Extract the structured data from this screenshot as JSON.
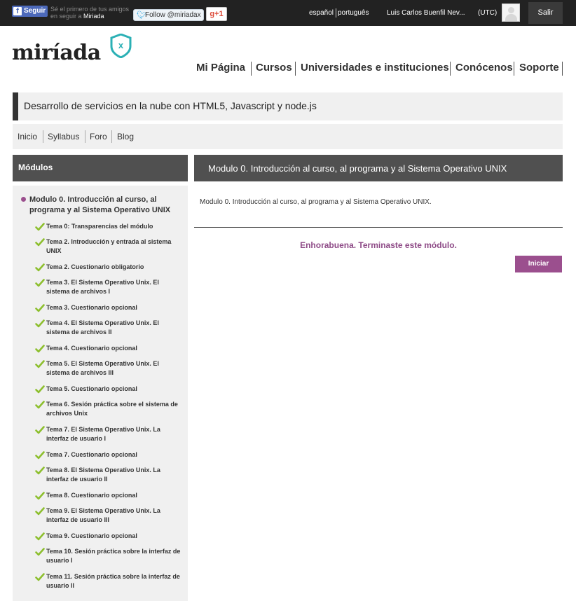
{
  "topbar": {
    "fb_label": "Seguir",
    "fb_note": "Sé el primero de tus amigos en seguir a",
    "fb_brand": "Miriada",
    "twitter_label": "Follow @miriadax",
    "gplus_label": "g+1",
    "languages": [
      "español",
      "português"
    ],
    "user_name": "Luis Carlos Buenfil Nev...",
    "timezone": "(UTC)",
    "logout_label": "Salir"
  },
  "header": {
    "logo_text": "miríada",
    "logo_badge": "x"
  },
  "main_nav": [
    {
      "label": "Mi Página"
    },
    {
      "label": "Cursos"
    },
    {
      "label": "Universidades e instituciones"
    },
    {
      "label": "Conócenos"
    },
    {
      "label": "Soporte"
    }
  ],
  "course": {
    "title": "Desarrollo de servicios en la nube con HTML5, Javascript y node.js",
    "tabs": [
      {
        "label": "Inicio"
      },
      {
        "label": "Syllabus"
      },
      {
        "label": "Foro"
      },
      {
        "label": "Blog"
      }
    ]
  },
  "sidebar": {
    "heading": "Módulos",
    "module_title": "Modulo 0. Introducción al curso, al programa y al Sistema Operativo UNIX",
    "topics": [
      {
        "label": "Tema 0: Transparencias del módulo",
        "status": "completed"
      },
      {
        "label": "Tema 2. Introducción y entrada al sistema UNIX",
        "status": "completed"
      },
      {
        "label": "Tema 2. Cuestionario obligatorio",
        "status": "completed"
      },
      {
        "label": "Tema 3. El Sistema Operativo Unix. El sistema de archivos I",
        "status": "completed"
      },
      {
        "label": "Tema 3. Cuestionario opcional",
        "status": "completed"
      },
      {
        "label": "Tema 4. El Sistema Operativo Unix. El sistema de archivos II",
        "status": "completed"
      },
      {
        "label": "Tema 4. Cuestionario opcional",
        "status": "completed"
      },
      {
        "label": "Tema 5. El Sistema Operativo Unix. El sistema de archivos III",
        "status": "completed"
      },
      {
        "label": "Tema 5. Cuestionario opcional",
        "status": "completed"
      },
      {
        "label": "Tema 6. Sesión práctica sobre el sistema de archivos Unix",
        "status": "completed"
      },
      {
        "label": "Tema 7. El Sistema Operativo Unix. La interfaz de usuario I",
        "status": "completed"
      },
      {
        "label": "Tema 7. Cuestionario opcional",
        "status": "completed"
      },
      {
        "label": "Tema 8. El Sistema Operativo Unix. La interfaz de usuario II",
        "status": "completed"
      },
      {
        "label": "Tema 8. Cuestionario opcional",
        "status": "completed"
      },
      {
        "label": "Tema 9. El Sistema Operativo Unix. La interfaz de usuario III",
        "status": "completed"
      },
      {
        "label": "Tema 9. Cuestionario opcional",
        "status": "completed"
      },
      {
        "label": "Tema 10. Sesión práctica sobre la interfaz de usuario I",
        "status": "completed"
      },
      {
        "label": "Tema 11. Sesión práctica sobre la interfaz de usuario II",
        "status": "completed"
      }
    ]
  },
  "content": {
    "heading": "Modulo 0. Introducción al curso, al programa y al Sistema Operativo UNIX",
    "description": "Modulo 0. Introducción al curso, al programa y al Sistema Operativo UNIX.",
    "congrats": "Enhorabuena. Terminaste este módulo.",
    "start_label": "Iniciar"
  },
  "colors": {
    "topbar_bg": "#222222",
    "accent_purple": "#9b4f8e",
    "check_green": "#8dbf2e",
    "logo_teal": "#2bb0b5",
    "panel_header": "#505050",
    "panel_bg": "#f0f0f0"
  }
}
